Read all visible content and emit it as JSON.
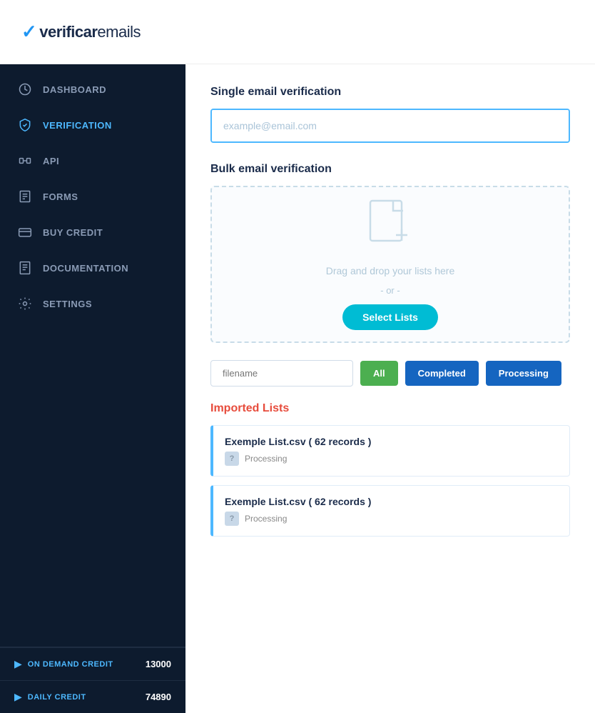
{
  "app": {
    "logo": "verificaremails",
    "logo_check": "✓"
  },
  "sidebar": {
    "nav_items": [
      {
        "id": "dashboard",
        "label": "DASHBOARD",
        "icon": "dashboard-icon",
        "active": false
      },
      {
        "id": "verification",
        "label": "VERIFICATION",
        "icon": "shield-icon",
        "active": true
      },
      {
        "id": "api",
        "label": "API",
        "icon": "api-icon",
        "active": false
      },
      {
        "id": "forms",
        "label": "FORMS",
        "icon": "forms-icon",
        "active": false
      },
      {
        "id": "buy-credit",
        "label": "BUY CREDIT",
        "icon": "credit-icon",
        "active": false
      },
      {
        "id": "documentation",
        "label": "DOCUMENTATION",
        "icon": "docs-icon",
        "active": false
      },
      {
        "id": "settings",
        "label": "SETTINGS",
        "icon": "settings-icon",
        "active": false
      }
    ],
    "credits": [
      {
        "id": "on-demand",
        "label": "ON DEMAND CREDIT",
        "value": "13000"
      },
      {
        "id": "daily",
        "label": "DAILY CREDIT",
        "value": "74890"
      }
    ]
  },
  "main": {
    "single_verification": {
      "title": "Single email verification",
      "input_placeholder": "example@email.com"
    },
    "bulk_verification": {
      "title": "Bulk email verification",
      "dropzone_text": "Drag and drop your lists here",
      "or_text": "- or -",
      "select_btn_label": "Select Lists"
    },
    "filter": {
      "filename_placeholder": "filename",
      "buttons": [
        {
          "id": "all",
          "label": "All",
          "type": "all"
        },
        {
          "id": "completed",
          "label": "Completed",
          "type": "completed"
        },
        {
          "id": "processing",
          "label": "Processing",
          "type": "processing"
        }
      ]
    },
    "imported_lists": {
      "title": "Imported Lists",
      "items": [
        {
          "name": "Exemple List.csv ( 62 records )",
          "status": "Processing"
        },
        {
          "name": "Exemple List.csv ( 62 records )",
          "status": "Processing"
        }
      ]
    }
  }
}
